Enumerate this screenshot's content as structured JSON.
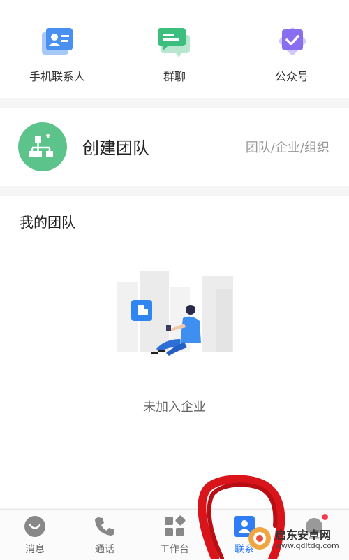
{
  "quick_entries": [
    {
      "label": "手机联系人",
      "icon": "phone-contacts-icon"
    },
    {
      "label": "群聊",
      "icon": "group-chat-icon"
    },
    {
      "label": "公众号",
      "icon": "official-account-icon"
    }
  ],
  "create_team": {
    "title": "创建团队",
    "subtitle": "团队/企业/组织",
    "icon": "org-chart-icon"
  },
  "my_team": {
    "title": "我的团队",
    "empty_text": "未加入企业"
  },
  "tabbar": [
    {
      "label": "消息",
      "icon": "message-icon",
      "active": false
    },
    {
      "label": "通话",
      "icon": "phone-icon",
      "active": false
    },
    {
      "label": "工作台",
      "icon": "workbench-icon",
      "active": false
    },
    {
      "label": "联系",
      "icon": "contacts-icon",
      "active": true
    },
    {
      "label": "",
      "icon": "me-icon",
      "active": false
    }
  ],
  "watermark": {
    "line1": "启东安卓网",
    "line2": "www.qdltdq.com"
  },
  "colors": {
    "accent": "#2f7df6",
    "team_green": "#5cc48a",
    "badge_red": "#f23d4f"
  }
}
